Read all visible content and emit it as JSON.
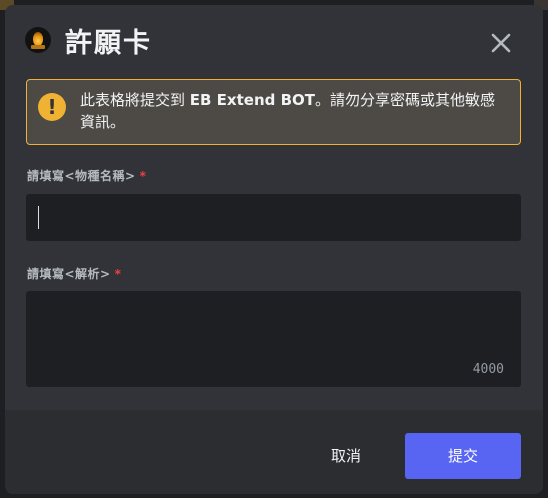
{
  "modal": {
    "title": "許願卡",
    "app_icon": "eb-extend-bot-avatar",
    "close_icon": "close-icon"
  },
  "warning": {
    "icon": "alert-icon",
    "icon_glyph": "!",
    "text_before": "此表格將提交到 ",
    "text_bold": "EB Extend BOT",
    "text_after": "。請勿分享密碼或其他敏感資訊。",
    "border_color": "#f0b232"
  },
  "fields": [
    {
      "label": "請填寫<物種名稱>",
      "required_mark": "*",
      "value": ""
    },
    {
      "label": "請填寫<解析>",
      "required_mark": "*",
      "value": "",
      "char_count": "4000"
    }
  ],
  "footer": {
    "cancel_label": "取消",
    "submit_label": "提交",
    "submit_color": "#5865f2"
  }
}
